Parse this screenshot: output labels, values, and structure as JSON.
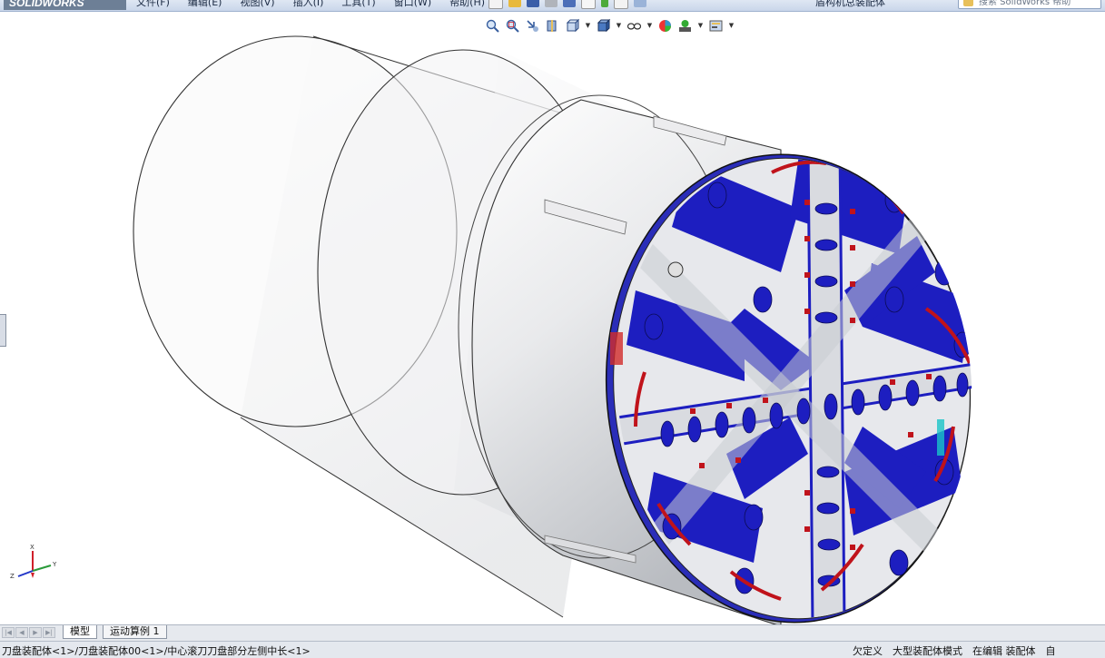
{
  "app": {
    "logo": "SOLIDWORKS",
    "menus": [
      "文件(F)",
      "编辑(E)",
      "视图(V)",
      "插入(I)",
      "工具(T)",
      "窗口(W)",
      "帮助(H)"
    ],
    "document_title": "盾构机总装配体",
    "help_search_placeholder": "搜索 SolidWorks 帮助"
  },
  "view_toolbar": {
    "icons": [
      "zoom-to-fit-icon",
      "zoom-to-area-icon",
      "previous-view-icon",
      "section-view-icon",
      "view-orientation-icon",
      "display-style-icon",
      "hide-show-items-icon",
      "edit-appearance-icon",
      "apply-scene-icon",
      "view-settings-icon"
    ]
  },
  "tabs": {
    "items": [
      {
        "label": "模型",
        "active": true
      },
      {
        "label": "运动算例 1",
        "active": false
      }
    ]
  },
  "status": {
    "path": "刀盘装配体<1>/刀盘装配体00<1>/中心滚刀刀盘部分左侧中长<1>",
    "right": [
      "欠定义",
      "大型装配体模式",
      "在编辑 装配体",
      "自"
    ]
  },
  "colors": {
    "cutterhead_blue": "#1d1ec0",
    "cutter_red": "#c0131b",
    "shield_grey": "#d6d8dc",
    "triad_x": "#d0202a",
    "triad_y": "#2a9a3a",
    "triad_z": "#2236c8"
  },
  "triad": {
    "x_label": "X",
    "y_label": "Y",
    "z_label": "Z"
  }
}
